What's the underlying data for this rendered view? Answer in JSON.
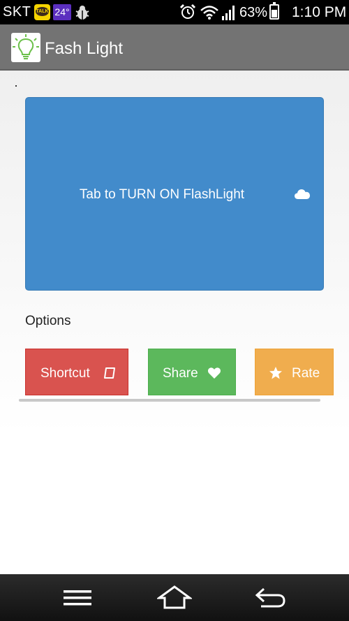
{
  "status_bar": {
    "carrier": "SKT",
    "talk_icon_text": "TALK",
    "temperature": "24°",
    "battery_percent": "63%",
    "battery_level": 0.63,
    "time": "1:10 PM",
    "icons": [
      "kakaotalk-icon",
      "weather-icon",
      "bug-icon",
      "alarm-icon",
      "wifi-icon",
      "signal-icon",
      "battery-charging-icon"
    ]
  },
  "action_bar": {
    "title": "Fash Light",
    "logo_icon": "lightbulb-icon"
  },
  "main": {
    "flash_button_label": "Tab to TURN ON FlashLight",
    "flash_button_icon": "cloud-icon",
    "options_label": "Options"
  },
  "options": {
    "shortcut_label": "Shortcut",
    "share_label": "Share",
    "rate_label": "Rate"
  },
  "colors": {
    "primary": "#428bcb",
    "danger": "#d9534f",
    "success": "#5cb85c",
    "warning": "#f0ad4e",
    "action_bar": "#737373"
  },
  "nav_bar": {
    "icons": [
      "menu-icon",
      "home-icon",
      "back-icon"
    ]
  }
}
